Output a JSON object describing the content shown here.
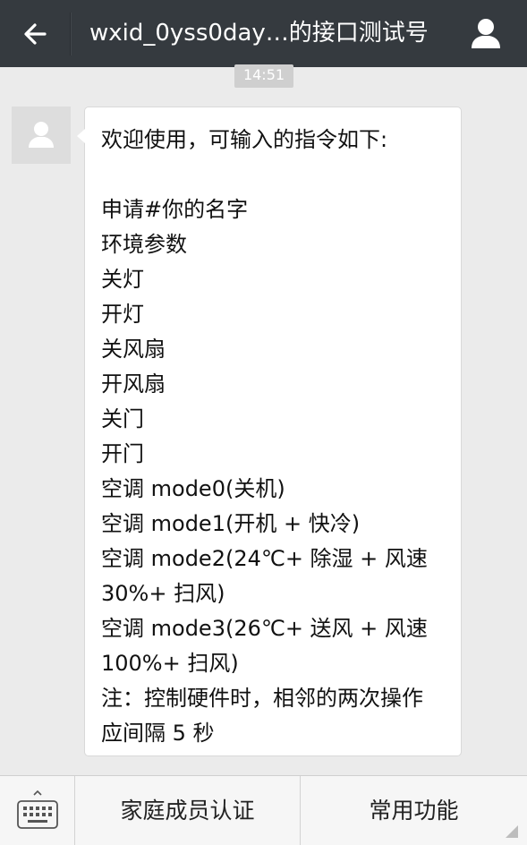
{
  "header": {
    "title": "wxid_0yss0day…的接口测试号",
    "back_icon": "back-arrow-icon",
    "profile_icon": "person-icon"
  },
  "chat": {
    "timestamp": "14:51",
    "message": {
      "lines": [
        "欢迎使用，可输入的指令如下:",
        "",
        "申请#你的名字",
        "环境参数",
        "关灯",
        "开灯",
        "关风扇",
        "开风扇",
        "关门",
        "开门",
        "空调 mode0(关机)",
        "空调 mode1(开机 + 快冷)",
        "空调 mode2(24℃+ 除湿 + 风速",
        "30%+ 扫风)",
        "空调 mode3(26℃+ 送风 + 风速",
        "100%+ 扫风)",
        "注：控制硬件时，相邻的两次操作",
        "应间隔 5 秒"
      ]
    }
  },
  "bottom_menu": {
    "keyboard_icon": "keyboard-icon",
    "items": [
      {
        "label": "家庭成员认证"
      },
      {
        "label": "常用功能"
      }
    ]
  },
  "colors": {
    "topbar": "#353a3f",
    "background": "#ebebeb",
    "bubble": "#ffffff"
  }
}
